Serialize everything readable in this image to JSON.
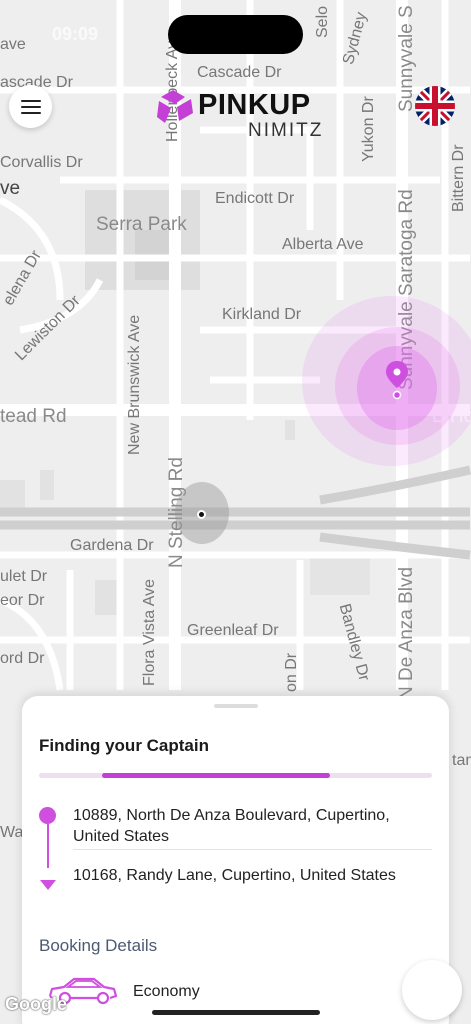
{
  "status_bar": {
    "time": "09:09"
  },
  "header": {
    "brand_name": "PINKUP",
    "brand_sub": "NIMITZ",
    "menu_icon": "hamburger-menu-icon",
    "language_icon": "uk-flag-icon"
  },
  "map": {
    "labels": [
      "Cascade Dr",
      "Endicott Dr",
      "Serra Park",
      "Alberta Ave",
      "Kirkland Dr",
      "tead Rd",
      "E Ho",
      "Gardena Dr",
      "Greenleaf Dr",
      "Corvallis Dr",
      "ve",
      "Lewiston Dr",
      "elena Dr",
      "ulet Dr",
      "eor Dr",
      "ord Dr",
      "ascade Dr",
      "ave",
      "Hollenbeck Ave",
      "New Brunswick Ave",
      "N Stelling Rd",
      "Flora Vista Ave",
      "on Dr",
      "Bandley Dr",
      "N De Anza Blvd",
      "Sunnyvale Saratoga Rd",
      "Yukon Dr",
      "Bittern Dr",
      "Selo",
      "Sydney",
      "Sunnyvale S",
      "tan",
      "War"
    ],
    "attribution": "Google",
    "accent": "#cf4fe0"
  },
  "sheet": {
    "title": "Finding your Captain",
    "progress": 0.58,
    "pickup": "10889, North De Anza Boulevard, Cupertino, United States",
    "dropoff": "10168, Randy Lane, Cupertino, United States",
    "booking_label": "Booking Details",
    "vehicle_type": "Economy",
    "vehicle_icon": "car-icon"
  }
}
